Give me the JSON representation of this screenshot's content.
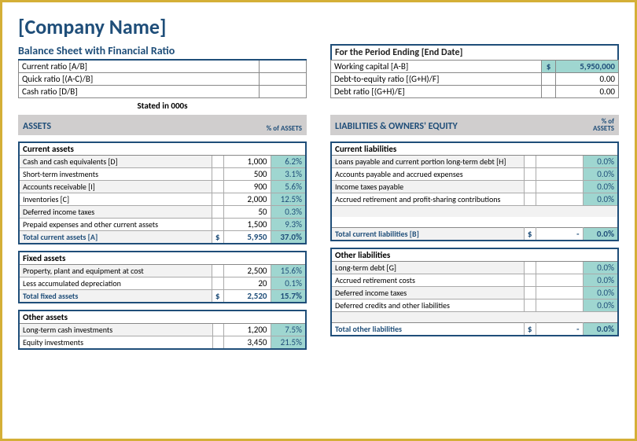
{
  "company_name": "[Company Name]",
  "sheet_title": "Balance Sheet with Financial Ratio",
  "period_title": "For the Period Ending [End Date]",
  "stated": "Stated in 000s",
  "left_ratios": [
    {
      "label": "Current ratio [A/B]",
      "value": ""
    },
    {
      "label": "Quick ratio [(A-C)/B]",
      "value": ""
    },
    {
      "label": "Cash ratio [D/B]",
      "value": ""
    }
  ],
  "right_ratios": [
    {
      "label": "Working capital [A-B]",
      "sym": "$",
      "value": "5,950,000",
      "hl": true
    },
    {
      "label": "Debt-to-equity ratio [(G+H)/F]",
      "sym": "",
      "value": "0.00",
      "hl": false
    },
    {
      "label": "Debt ratio [(G+H)/E]",
      "sym": "",
      "value": "0.00",
      "hl": false
    }
  ],
  "assets_header": "ASSETS",
  "pct_assets_label": "% of ASSETS",
  "liab_header": "LIABILITIES & OWNERS' EQUITY",
  "pct_assets_label2": "% of\nASSETS",
  "current_assets": {
    "title": "Current assets",
    "rows": [
      {
        "label": "Cash and cash equivalents [D]",
        "value": "1,000",
        "pct": "6.2%"
      },
      {
        "label": "Short-term investments",
        "value": "500",
        "pct": "3.1%"
      },
      {
        "label": "Accounts receivable [I]",
        "value": "900",
        "pct": "5.6%"
      },
      {
        "label": "Inventories [C]",
        "value": "2,000",
        "pct": "12.5%"
      },
      {
        "label": "Deferred income taxes",
        "value": "50",
        "pct": "0.3%"
      },
      {
        "label": "Prepaid expenses and other current assets",
        "value": "1,500",
        "pct": "9.3%"
      }
    ],
    "total": {
      "label": "Total current assets [A]",
      "sym": "$",
      "value": "5,950",
      "pct": "37.0%"
    }
  },
  "fixed_assets": {
    "title": "Fixed assets",
    "rows": [
      {
        "label": "Property, plant and equipment at cost",
        "value": "2,500",
        "pct": "15.6%"
      },
      {
        "label": "Less accumulated depreciation",
        "value": "20",
        "pct": "0.1%"
      }
    ],
    "total": {
      "label": "Total fixed assets",
      "sym": "$",
      "value": "2,520",
      "pct": "15.7%"
    }
  },
  "other_assets": {
    "title": "Other assets",
    "rows": [
      {
        "label": "Long-term cash investments",
        "value": "1,200",
        "pct": "7.5%"
      },
      {
        "label": "Equity investments",
        "value": "3,450",
        "pct": "21.5%"
      }
    ]
  },
  "current_liab": {
    "title": "Current liabilities",
    "rows": [
      {
        "label": "Loans payable and current portion long-term debt [H]",
        "value": "",
        "pct": "0.0%"
      },
      {
        "label": "Accounts payable and accrued expenses",
        "value": "",
        "pct": "0.0%"
      },
      {
        "label": "Income taxes payable",
        "value": "",
        "pct": "0.0%"
      },
      {
        "label": "Accrued retirement and profit-sharing contributions",
        "value": "",
        "pct": "0.0%"
      }
    ],
    "total": {
      "label": "Total current liabilities [B]",
      "sym": "$",
      "value": "-",
      "pct": "0.0%"
    }
  },
  "other_liab": {
    "title": "Other liabilities",
    "rows": [
      {
        "label": "Long-term debt [G]",
        "value": "",
        "pct": "0.0%"
      },
      {
        "label": "Accrued retirement costs",
        "value": "",
        "pct": "0.0%"
      },
      {
        "label": "Deferred income taxes",
        "value": "",
        "pct": "0.0%"
      },
      {
        "label": "Deferred credits and other liabilities",
        "value": "",
        "pct": "0.0%"
      }
    ],
    "total": {
      "label": "Total other liabilities",
      "sym": "$",
      "value": "-",
      "pct": "0.0%"
    }
  }
}
